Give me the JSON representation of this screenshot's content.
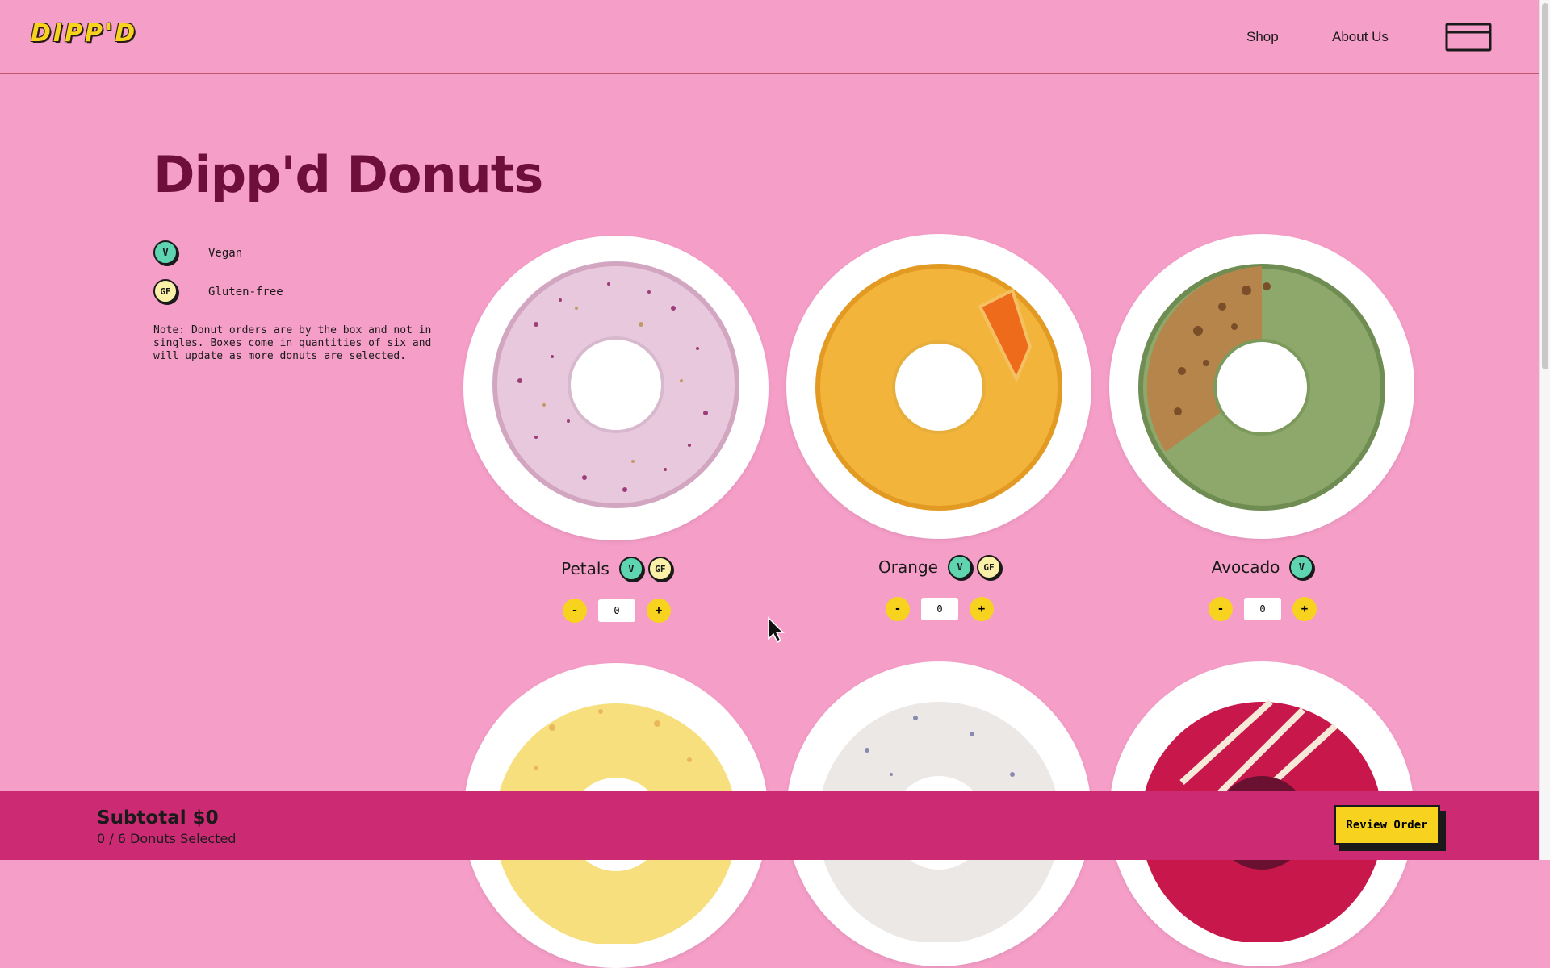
{
  "header": {
    "logo": "DIPP'D",
    "nav": [
      "Shop",
      "About Us"
    ],
    "cart_icon": "box-icon"
  },
  "page": {
    "title": "Dipp'd Donuts",
    "legend": [
      {
        "badge": "V",
        "label": "Vegan"
      },
      {
        "badge": "GF",
        "label": "Gluten-free"
      }
    ],
    "note": "Note: Donut orders are by the box and not in singles. Boxes come in quantities of six and will update as more donuts are selected."
  },
  "products": [
    {
      "name": "Petals",
      "badges": [
        "V",
        "GF"
      ],
      "quantity": "0",
      "minus": "-",
      "plus": "+"
    },
    {
      "name": "Orange",
      "badges": [
        "V",
        "GF"
      ],
      "quantity": "0",
      "minus": "-",
      "plus": "+"
    },
    {
      "name": "Avocado",
      "badges": [
        "V"
      ],
      "quantity": "0",
      "minus": "-",
      "plus": "+"
    }
  ],
  "footer": {
    "subtotal": "Subtotal $0",
    "selected": "0 / 6 Donuts Selected",
    "review_label": "Review Order"
  },
  "colors": {
    "background": "#f59ec8",
    "title": "#6e0f3b",
    "accent_yellow": "#f7d21e",
    "footer_bar": "#cc2b74",
    "vegan_badge": "#5fd4b0",
    "gf_badge": "#fbf0a8"
  }
}
